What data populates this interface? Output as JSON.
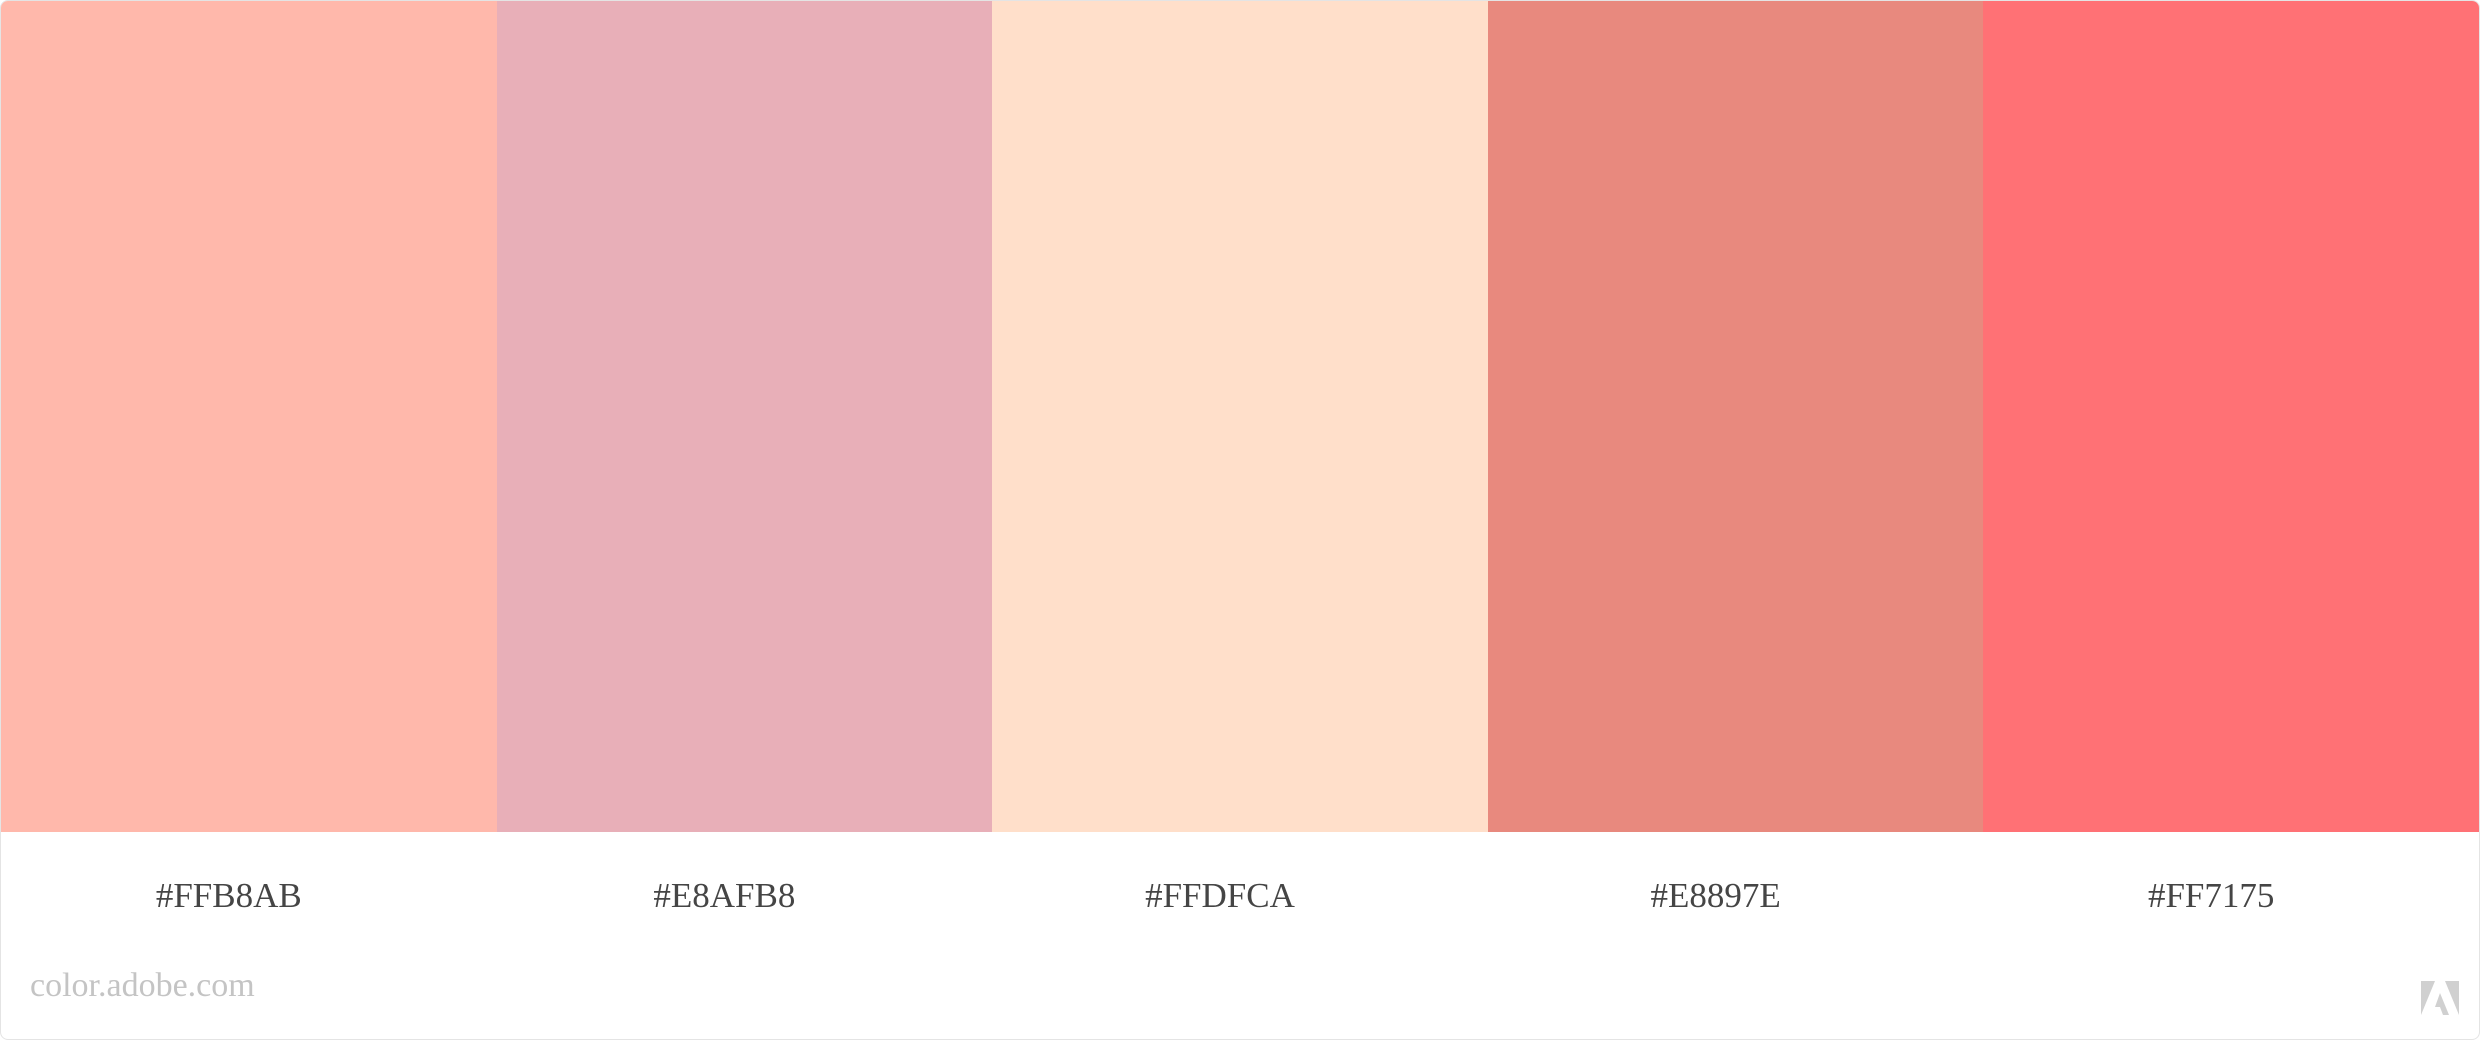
{
  "palette": {
    "swatches": [
      {
        "hex": "#FFB8AB",
        "color": "#FFB8AB"
      },
      {
        "hex": "#E8AFB8",
        "color": "#E8AFB8"
      },
      {
        "hex": "#FFDFCA",
        "color": "#FFDFCA"
      },
      {
        "hex": "#E8897E",
        "color": "#E8897E"
      },
      {
        "hex": "#FF7175",
        "color": "#FF7175"
      }
    ]
  },
  "footer": {
    "watermark": "color.adobe.com",
    "logo_icon": "adobe-logo-icon"
  },
  "colors": {
    "label_text": "#454545",
    "watermark_text": "#C4C4C4",
    "background": "#FFFFFF"
  }
}
